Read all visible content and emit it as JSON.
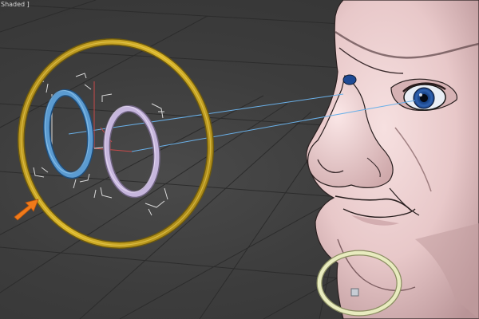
{
  "viewport": {
    "label": "Shaded ]",
    "mode": "shaded",
    "colors": {
      "background": "#3d3d3d",
      "grid": "#2c2c2c",
      "helper_ring": "#c9a21a",
      "left_eye_ring": "#5b9bd1",
      "right_eye_ring": "#c6b6dd",
      "jaw_ring": "#e8ebbf",
      "skin": "#e8c8c9",
      "iris": "#2f62b0",
      "sightline": "#6ab0e8",
      "arrow": "#f07a1a"
    }
  },
  "scene": {
    "objects": [
      {
        "name": "head-mesh",
        "icon": "head-model"
      },
      {
        "name": "eye-look-at-control",
        "icon": "ring"
      },
      {
        "name": "left-eye-target",
        "icon": "ring"
      },
      {
        "name": "right-eye-target",
        "icon": "ring"
      },
      {
        "name": "jaw-control",
        "icon": "ring"
      },
      {
        "name": "pivot-gizmo",
        "icon": "transform-gizmo"
      },
      {
        "name": "pointer-arrow",
        "icon": "arrow-icon"
      }
    ]
  }
}
